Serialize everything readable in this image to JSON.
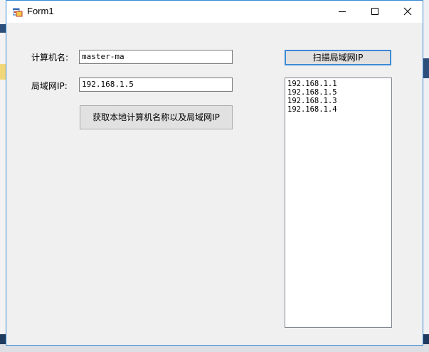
{
  "window": {
    "title": "Form1"
  },
  "form": {
    "computer_name_label": "计算机名:",
    "computer_name_value": "master-ma",
    "lan_ip_label": "局域网IP:",
    "lan_ip_value": "192.168.1.5",
    "get_local_button": "获取本地计算机名称以及局域网IP",
    "scan_button": "扫描局域网IP",
    "ip_list": [
      "192.168.1.1",
      "192.168.1.5",
      "192.168.1.3",
      "192.168.1.4"
    ]
  },
  "colors": {
    "window_border": "#3c8ad6",
    "button_face": "#e1e1e1",
    "form_background": "#f0f0f0"
  },
  "icons": {
    "app": "winforms-app-icon",
    "minimize": "minimize-icon",
    "maximize": "maximize-icon",
    "close": "close-icon"
  }
}
